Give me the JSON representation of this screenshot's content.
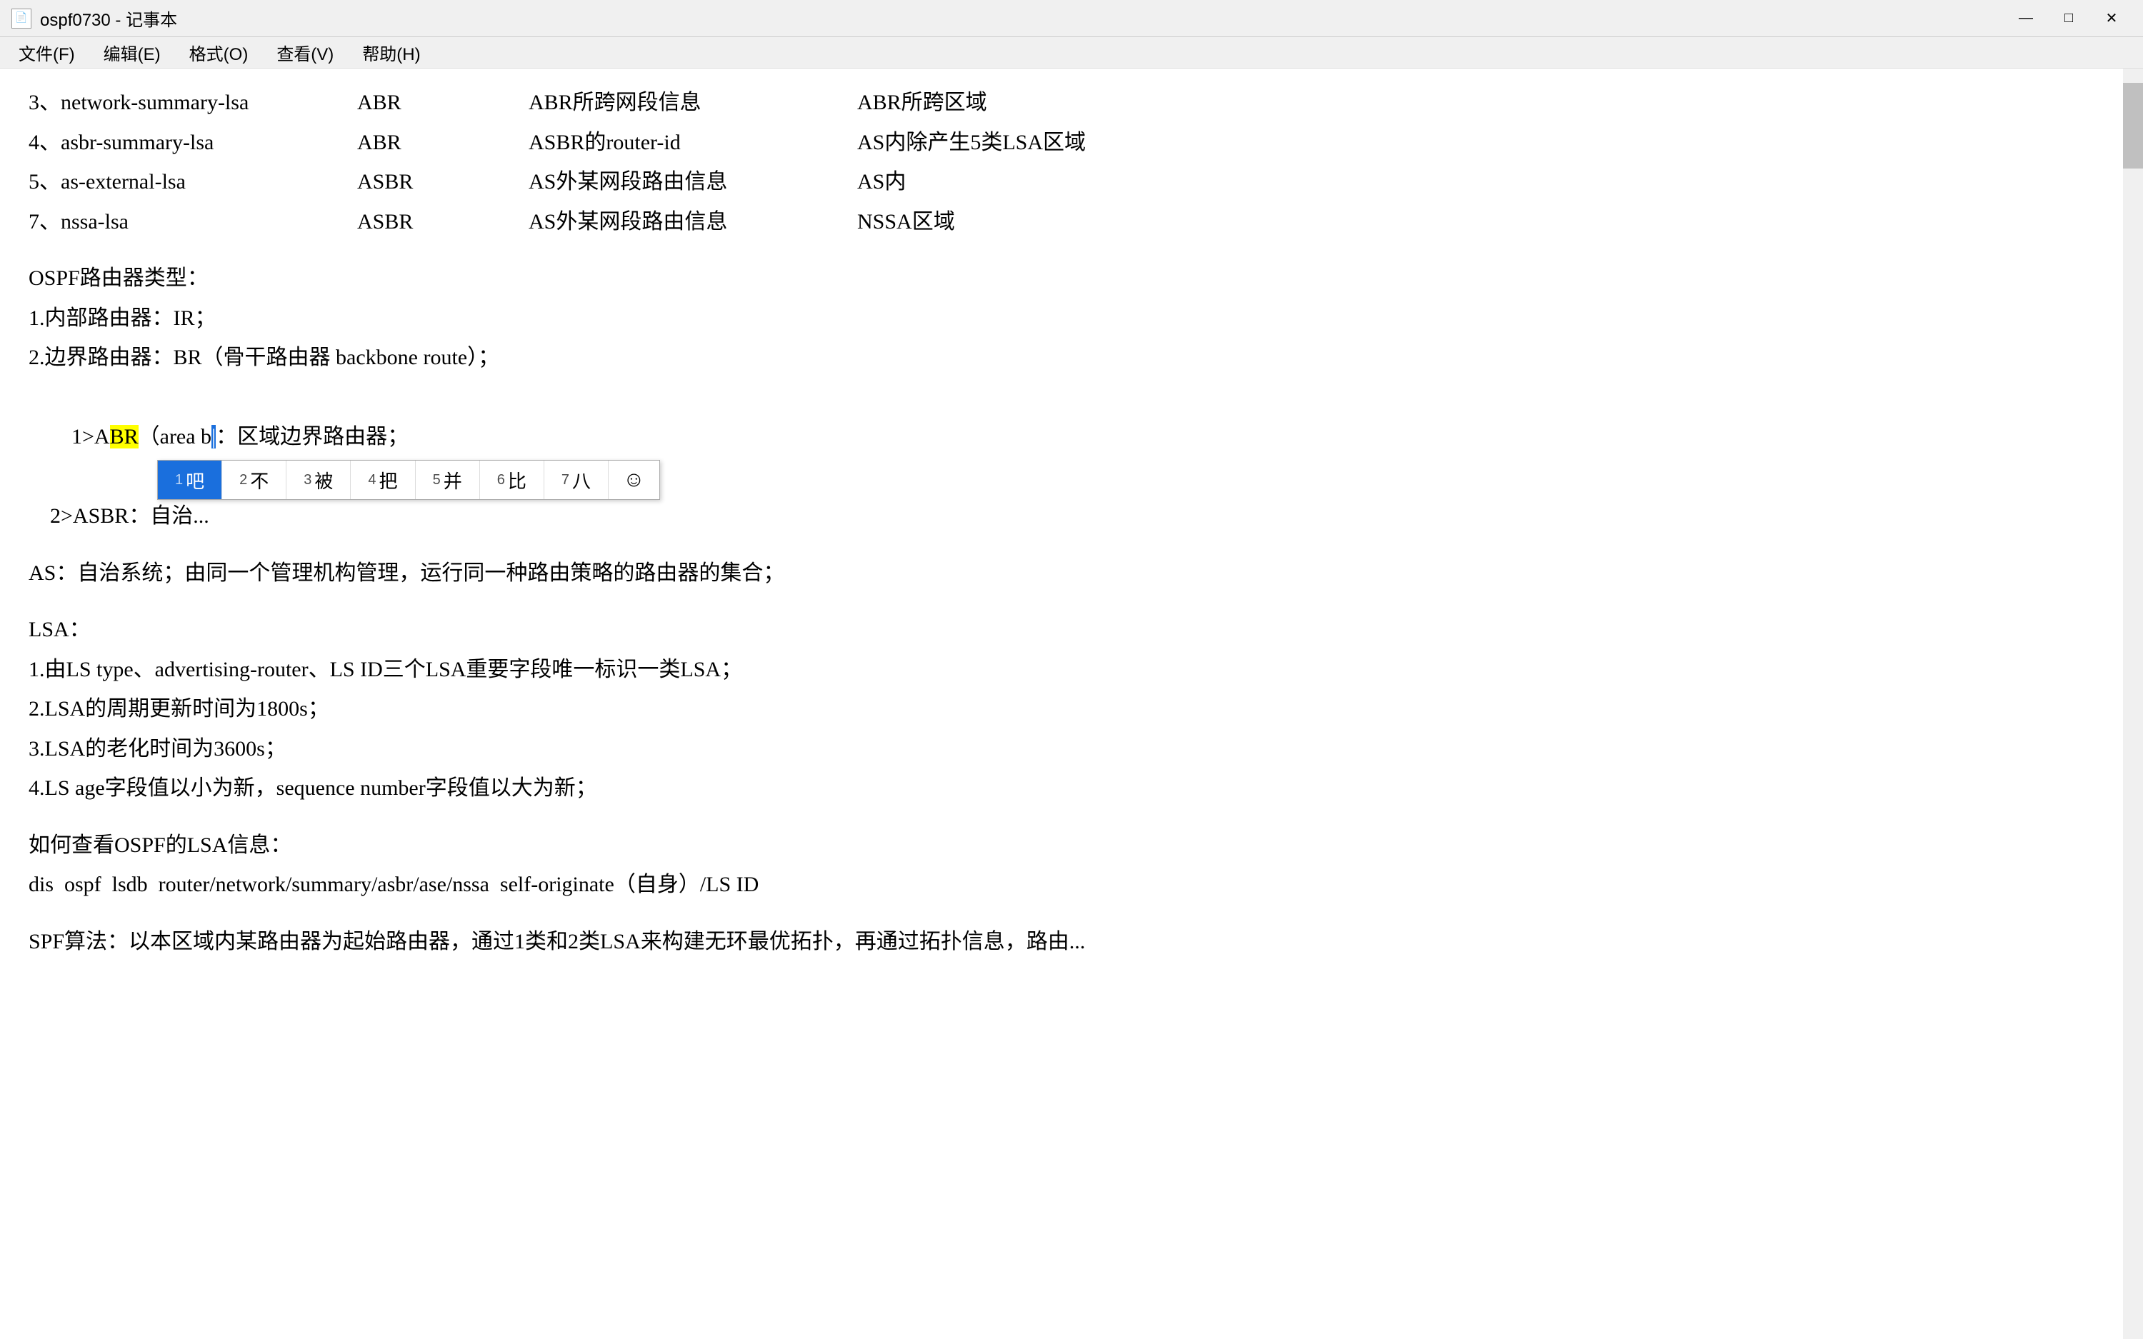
{
  "window": {
    "title": "ospf0730 - 记事本",
    "icon": "📄"
  },
  "titlebar": {
    "minimize": "—",
    "maximize": "□",
    "close": "✕"
  },
  "menubar": {
    "items": [
      "文件(F)",
      "编辑(E)",
      "格式(O)",
      "查看(V)",
      "帮助(H)"
    ]
  },
  "content": {
    "table_rows": [
      {
        "col1": "3、network-summary-lsa",
        "col2": "ABR",
        "col3": "ABR所跨网段信息",
        "col4": "ABR所跨区域"
      },
      {
        "col1": "4、asbr-summary-lsa",
        "col2": "ABR",
        "col3": "ASBR的router-id",
        "col4": "AS内除产生5类LSA区域"
      },
      {
        "col1": "5、as-external-lsa",
        "col2": "ASBR",
        "col3": "AS外某网段路由信息",
        "col4": "AS内"
      },
      {
        "col1": "7、nssa-lsa",
        "col2": "ASBR",
        "col3": "AS外某网段路由信息",
        "col4": "NSSA区域"
      }
    ],
    "sections": [
      {
        "type": "heading",
        "text": "OSPF路由器类型："
      },
      {
        "type": "line",
        "text": "1.内部路由器：IR；"
      },
      {
        "type": "line",
        "text": "2.边界路由器：BR（骨干路由器 backbone route）；"
      },
      {
        "type": "line_indent",
        "prefix": "    1>A",
        "highlight_abr": "BR",
        "suffix_before_ime": "（area b",
        "suffix_after_ime": "：区域边界路由器；",
        "full": "    1>ABR（area b：区域边界路由器；"
      },
      {
        "type": "line_indent",
        "text": "    2>ASBR：自治...",
        "full": "    2>ASBR：自治..."
      },
      {
        "type": "blank"
      },
      {
        "type": "line",
        "text": "AS：自治系统；由同一个管理机构管理，运行同一种路由策略的路由器的集合；"
      },
      {
        "type": "blank"
      },
      {
        "type": "heading",
        "text": "LSA："
      },
      {
        "type": "line",
        "text": "1.由LS type、advertising-router、LS ID三个LSA重要字段唯一标识一类LSA；"
      },
      {
        "type": "line",
        "text": "2.LSA的周期更新时间为1800s；"
      },
      {
        "type": "line",
        "text": "3.LSA的老化时间为3600s；"
      },
      {
        "type": "line",
        "text": "4.LS age字段值以小为新，sequence number字段值以大为新；"
      },
      {
        "type": "blank"
      },
      {
        "type": "heading",
        "text": "如何查看OSPF的LSA信息："
      },
      {
        "type": "line",
        "text": "dis  ospf  lsdb  router/network/summary/asbr/ase/nssa  self-originate（自身）/LS ID"
      },
      {
        "type": "blank"
      },
      {
        "type": "line",
        "text": "SPF算法：以本区域内某路由器为起始路由器，通过1类和2类LSA来构建无环最优拓扑，再通过拓扑信息，路由..."
      }
    ],
    "ime": {
      "candidates": [
        {
          "num": "1",
          "char": "吧"
        },
        {
          "num": "2",
          "char": "不"
        },
        {
          "num": "3",
          "char": "被"
        },
        {
          "num": "4",
          "char": "把"
        },
        {
          "num": "5",
          "char": "并"
        },
        {
          "num": "6",
          "char": "比"
        },
        {
          "num": "7",
          "char": "八"
        }
      ],
      "emoji": "☺"
    }
  }
}
